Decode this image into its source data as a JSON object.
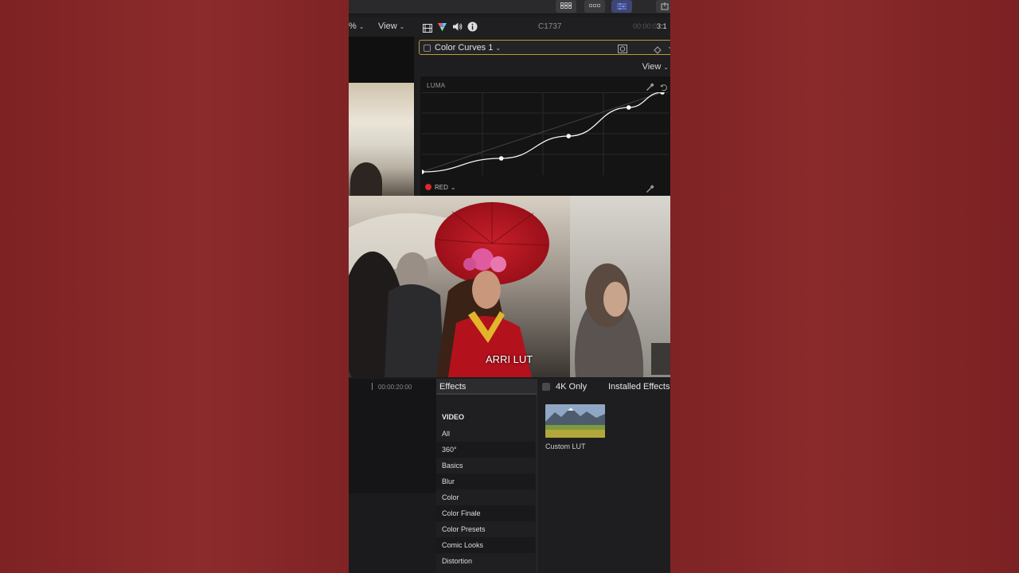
{
  "toolbar": {
    "zoom_fragment": "%",
    "view_label": "View",
    "clip_name": "C1737",
    "timecode_dim": "00:00:0",
    "timecode_bright": "3:1"
  },
  "inspector": {
    "effect_name": "Color Curves 1",
    "view_label": "View",
    "curves": {
      "luma_label": "LUMA",
      "red_label": "RED",
      "red_color": "#e0262e",
      "curve_points_input": [
        0,
        0.33,
        0.61,
        0.86,
        1
      ],
      "curve_points_output": [
        0,
        0.17,
        0.45,
        0.81,
        1
      ]
    }
  },
  "viewer": {
    "caption": "ARRI LUT"
  },
  "timeline": {
    "timecode": "00:00:20:00"
  },
  "effects_browser": {
    "title": "Effects",
    "section": "VIDEO",
    "categories": [
      "All",
      "360°",
      "Basics",
      "Blur",
      "Color",
      "Color Finale",
      "Color Presets",
      "Comic Looks",
      "Distortion"
    ],
    "filter_label": "4K Only",
    "installed_label": "Installed Effects",
    "items": [
      {
        "name": "Custom LUT"
      }
    ]
  }
}
